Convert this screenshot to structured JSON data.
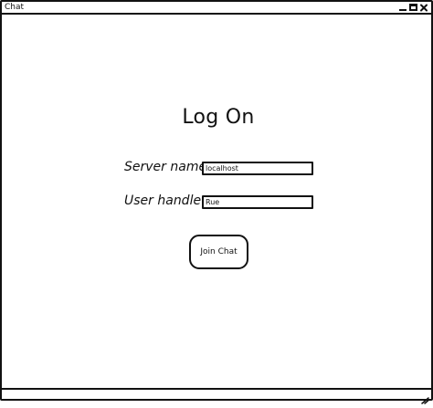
{
  "window": {
    "title": "Chat"
  },
  "main": {
    "heading": "Log On",
    "server_label": "Server name",
    "server_value": "localhost",
    "handle_label": "User handle",
    "handle_value": "Rue",
    "join_button_label": "Join Chat"
  },
  "icons": {
    "minimize": "minimize-icon",
    "maximize": "maximize-icon",
    "close": "close-icon",
    "resize": "resize-grip-icon"
  },
  "colors": {
    "ink": "#111111",
    "background": "#ffffff"
  }
}
